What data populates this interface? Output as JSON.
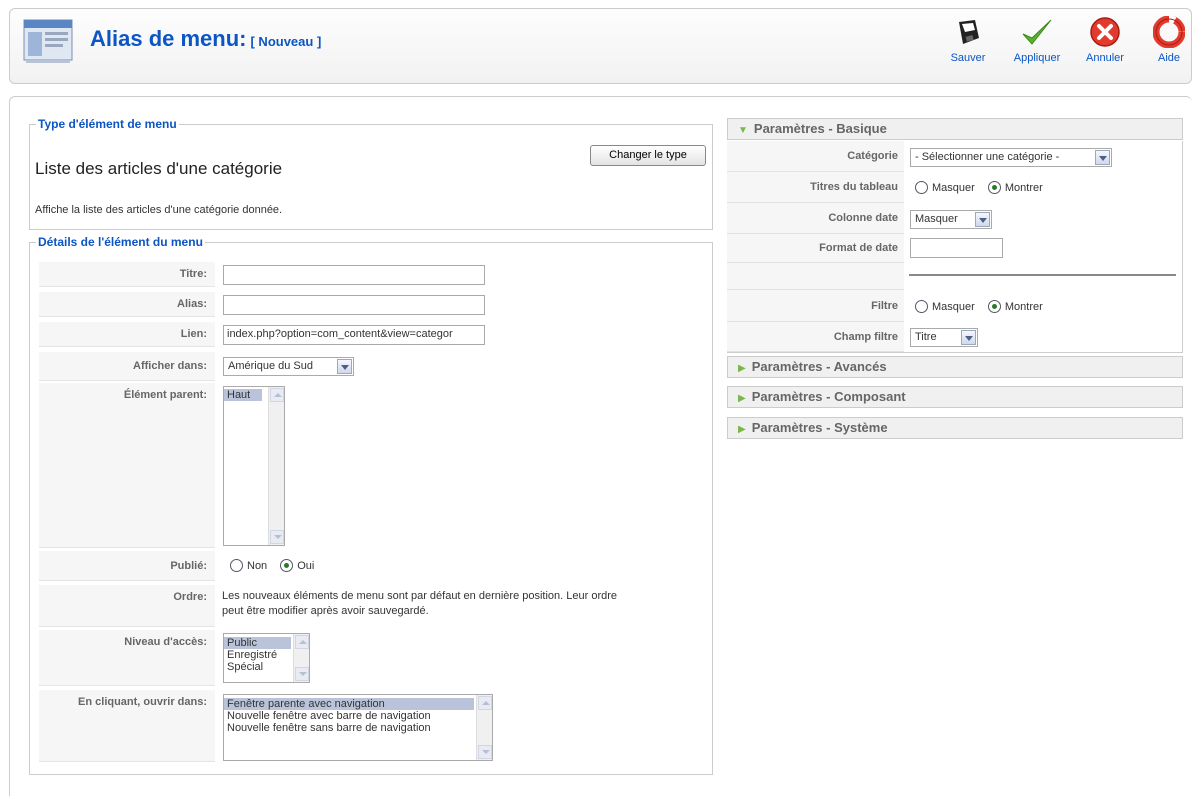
{
  "header": {
    "title": "Alias de menu:",
    "subtitle": "[ Nouveau ]",
    "buttons": {
      "save": "Sauver",
      "apply": "Appliquer",
      "cancel": "Annuler",
      "help": "Aide"
    }
  },
  "type_section": {
    "legend": "Type d'élément de menu",
    "title": "Liste des articles d'une catégorie",
    "description": "Affiche la liste des articles d'une catégorie donnée.",
    "change_button": "Changer le type"
  },
  "details": {
    "legend": "Détails de l'élément du menu",
    "fields": {
      "title_label": "Titre:",
      "title_value": "",
      "alias_label": "Alias:",
      "alias_value": "",
      "link_label": "Lien:",
      "link_value": "index.php?option=com_content&view=categor",
      "display_in_label": "Afficher dans:",
      "display_in_value": "Amérique du Sud",
      "parent_label": "Élément parent:",
      "parent_options": [
        "Haut"
      ],
      "published_label": "Publié:",
      "published_options": [
        "Non",
        "Oui"
      ],
      "published_selected": "Oui",
      "order_label": "Ordre:",
      "order_text_line1": "Les nouveaux éléments de menu sont par défaut en dernière position. Leur ordre",
      "order_text_line2": "peut être modifier après avoir sauvegardé.",
      "access_label": "Niveau d'accès:",
      "access_options": [
        "Public",
        "Enregistré",
        "Spécial"
      ],
      "access_selected": "Public",
      "open_in_label": "En cliquant, ouvrir dans:",
      "open_in_options": [
        "Fenêtre parente avec navigation",
        "Nouvelle fenêtre avec barre de navigation",
        "Nouvelle fenêtre sans barre de navigation"
      ],
      "open_in_selected": "Fenêtre parente avec navigation"
    }
  },
  "params": {
    "basic_header": "Paramètres - Basique",
    "category_label": "Catégorie",
    "category_value": "- Sélectionner une catégorie -",
    "table_titles_label": "Titres du tableau",
    "table_titles_options": [
      "Masquer",
      "Montrer"
    ],
    "table_titles_selected": "Montrer",
    "date_column_label": "Colonne date",
    "date_column_value": "Masquer",
    "date_format_label": "Format de date",
    "date_format_value": "",
    "filter_label": "Filtre",
    "filter_options": [
      "Masquer",
      "Montrer"
    ],
    "filter_selected": "Montrer",
    "filter_field_label": "Champ filtre",
    "filter_field_value": "Titre",
    "advanced_header": "Paramètres - Avancés",
    "component_header": "Paramètres - Composant",
    "system_header": "Paramètres - Système"
  },
  "colors": {
    "accent": "#0b55c4",
    "label_bg": "#f6f6f6",
    "selected_bg": "#b9c4da"
  }
}
